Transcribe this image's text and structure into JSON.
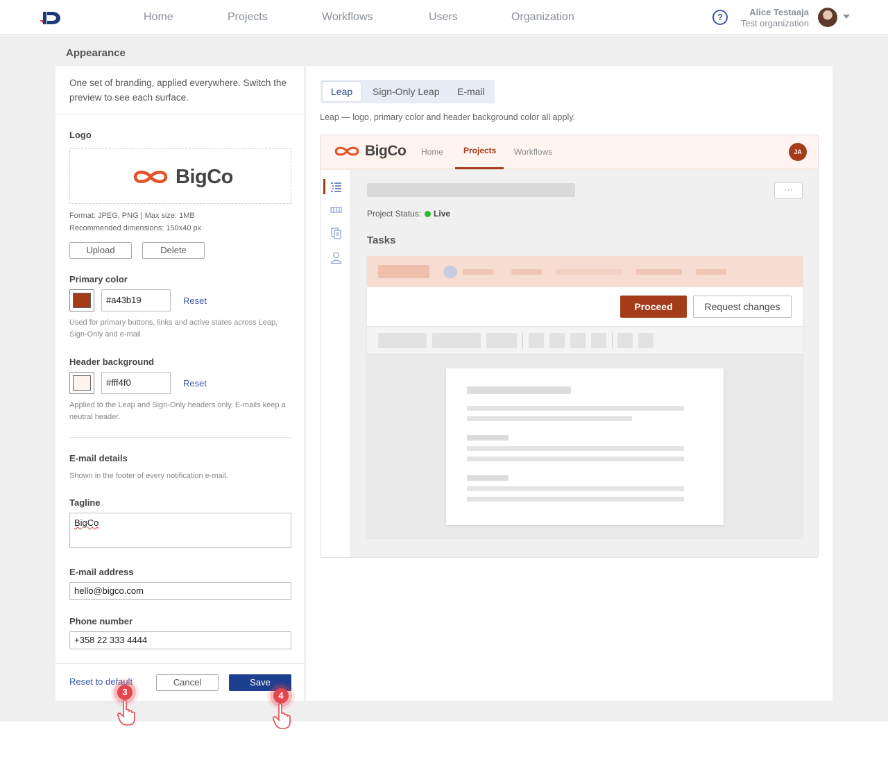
{
  "nav": {
    "items": [
      "Home",
      "Projects",
      "Workflows",
      "Users",
      "Organization"
    ],
    "help_glyph": "?",
    "user_name": "Alice Testaaja",
    "user_org": "Test organization"
  },
  "page": {
    "title": "Appearance"
  },
  "settings": {
    "intro": "One set of branding, applied everywhere. Switch the preview to see each surface.",
    "logo": {
      "label": "Logo",
      "brand_text": "BigCo",
      "format": "Format: JPEG, PNG | Max size: 1MB",
      "dimensions": "Recommended dimensions: 150x40 px",
      "upload": "Upload",
      "delete": "Delete"
    },
    "primary": {
      "label": "Primary color",
      "value": "#a43b19",
      "reset": "Reset",
      "help": "Used for primary buttons, links and active states across Leap, Sign-Only and e-mail."
    },
    "header_bg": {
      "label": "Header background",
      "value": "#fff4f0",
      "reset": "Reset",
      "help": "Applied to the Leap and Sign-Only headers only. E-mails keep a neutral header."
    },
    "email": {
      "label": "E-mail details",
      "help": "Shown in the footer of every notification e-mail.",
      "tagline_label": "Tagline",
      "tagline": "BigCo",
      "address_label": "E-mail address",
      "address": "hello@bigco.com",
      "phone_label": "Phone number",
      "phone": "+358 22 333 4444"
    },
    "footer": {
      "reset": "Reset to default",
      "cancel": "Cancel",
      "save": "Save"
    }
  },
  "preview": {
    "tabs": [
      "Leap",
      "Sign-Only Leap",
      "E-mail"
    ],
    "active_tab": "Leap",
    "caption": "Leap — logo, primary color and header background color all apply.",
    "brand": "BigCo",
    "nav": [
      "Home",
      "Projects",
      "Workflows"
    ],
    "active_nav": "Projects",
    "avatar": "JA",
    "more": "···",
    "status_label": "Project Status:",
    "status_value": "Live",
    "tasks": "Tasks",
    "proceed": "Proceed",
    "request": "Request changes",
    "icons": [
      "task-list-icon",
      "workflow-icon",
      "documents-icon",
      "person-icon"
    ]
  },
  "markers": [
    "3",
    "4"
  ],
  "colors": {
    "primary": "#a43b19",
    "header_bg": "#fff4f0",
    "link": "#3b5bab",
    "save": "#1d3f8f",
    "live": "#2eb82e",
    "marker": "#e4474e"
  }
}
